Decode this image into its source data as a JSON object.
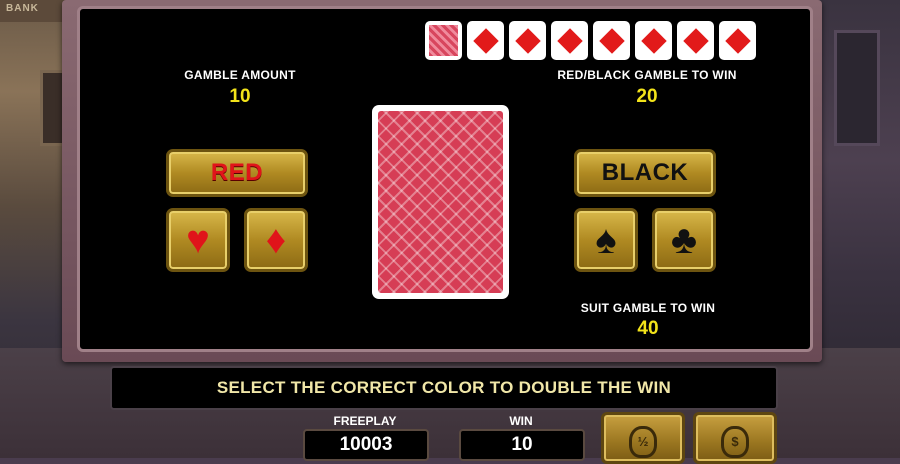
{
  "background": {
    "sign_text": "BANK"
  },
  "history": {
    "cards": [
      {
        "type": "back"
      },
      {
        "type": "diamond"
      },
      {
        "type": "diamond"
      },
      {
        "type": "diamond"
      },
      {
        "type": "diamond"
      },
      {
        "type": "diamond"
      },
      {
        "type": "diamond"
      },
      {
        "type": "diamond"
      }
    ]
  },
  "gamble_amount": {
    "label": "GAMBLE AMOUNT",
    "value": "10"
  },
  "red_black": {
    "label": "RED/BLACK GAMBLE TO WIN",
    "value": "20"
  },
  "suit_gamble": {
    "label": "SUIT GAMBLE TO WIN",
    "value": "40"
  },
  "buttons": {
    "red": "RED",
    "black": "BLACK",
    "hearts_icon": "heart-icon",
    "diamonds_icon": "diamond-icon",
    "spades_icon": "spade-icon",
    "clubs_icon": "club-icon"
  },
  "message": "SELECT THE CORRECT COLOR TO DOUBLE THE WIN",
  "freeplay": {
    "label": "FREEPLAY",
    "value": "10003"
  },
  "win": {
    "label": "WIN",
    "value": "10"
  },
  "collect_half": {
    "icon": "money-bag-half-icon",
    "glyph": "½"
  },
  "collect_all": {
    "icon": "money-bag-dollar-icon",
    "glyph": "$"
  },
  "colors": {
    "accent_gold": "#b08a22",
    "value_yellow": "#f2e31a",
    "red": "#e0141a"
  }
}
